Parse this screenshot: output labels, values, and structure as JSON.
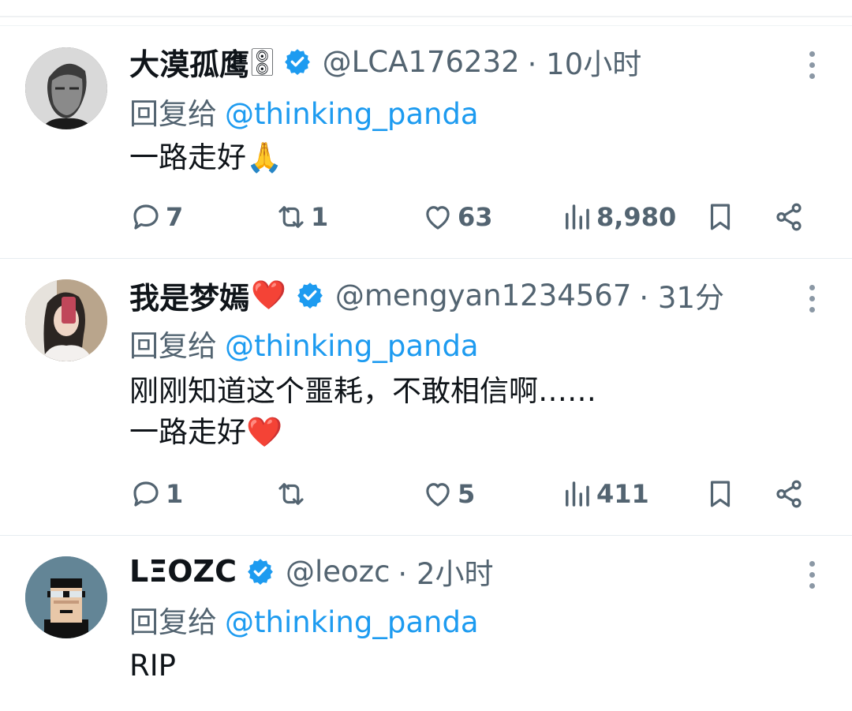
{
  "tweets": [
    {
      "name": "大漠孤鹰",
      "name_suffix": "🀚",
      "handle": "@LCA176232",
      "time": "· 10小时",
      "reply_label": "回复给",
      "reply_handle": "@thinking_panda",
      "text_lines": [
        "一路走好🙏"
      ],
      "replies": "7",
      "reposts": "1",
      "likes": "63",
      "views": "8,980",
      "avatar_icon": "portrait-photo"
    },
    {
      "name": "我是梦嫣",
      "name_suffix": "❤️",
      "handle": "@mengyan1234567",
      "time": "· 31分",
      "reply_label": "回复给",
      "reply_handle": "@thinking_panda",
      "text_lines": [
        "刚刚知道这个噩耗，不敢相信啊……",
        "一路走好❤️"
      ],
      "replies": "1",
      "reposts": "",
      "likes": "5",
      "views": "411",
      "avatar_icon": "selfie-photo"
    },
    {
      "name": "LΞOZC",
      "name_suffix": "",
      "handle": "@leozc",
      "time": "· 2小时",
      "reply_label": "回复给",
      "reply_handle": "@thinking_panda",
      "text_lines": [
        "RIP"
      ],
      "avatar_icon": "pixel-art-avatar"
    }
  ],
  "colors": {
    "accent": "#1d9bf0",
    "secondary_text": "#536471",
    "primary_text": "#0f1419",
    "divider": "#e6ecf0"
  }
}
